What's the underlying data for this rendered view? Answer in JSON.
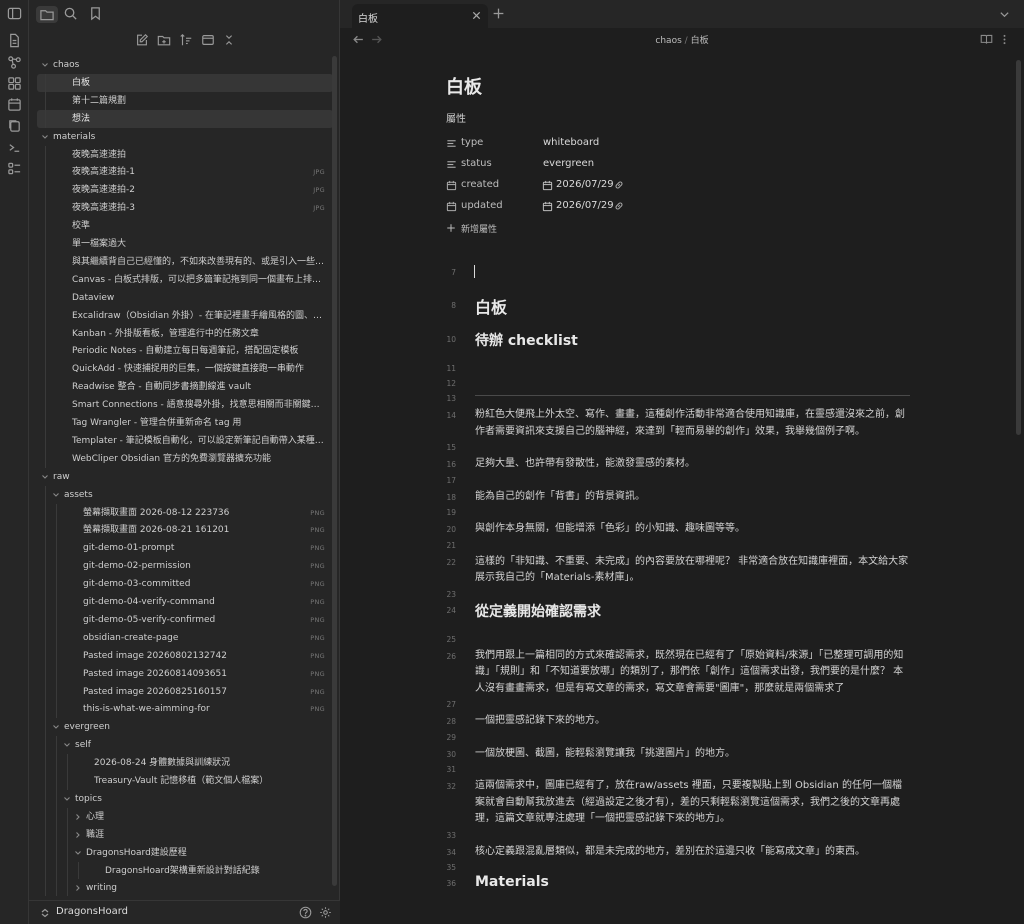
{
  "tab": {
    "title": "白板"
  },
  "breadcrumb": {
    "folder": "chaos",
    "separator": "/",
    "note": "白板"
  },
  "sidebar": {
    "vault_name": "DragonsHoard",
    "tree": [
      {
        "label": "chaos",
        "depth": 0,
        "type": "folder",
        "open": true
      },
      {
        "label": "白板",
        "depth": 1,
        "type": "file",
        "selected": true
      },
      {
        "label": "第十二篇規劃",
        "depth": 1,
        "type": "file"
      },
      {
        "label": "想法",
        "depth": 1,
        "type": "file",
        "selected": true
      },
      {
        "label": "materials",
        "depth": 0,
        "type": "folder",
        "open": true
      },
      {
        "label": "夜晚高速速拍",
        "depth": 1,
        "type": "file"
      },
      {
        "label": "夜晚高速速拍-1",
        "depth": 1,
        "type": "file",
        "ext": "JPG"
      },
      {
        "label": "夜晚高速速拍-2",
        "depth": 1,
        "type": "file",
        "ext": "JPG"
      },
      {
        "label": "夜晚高速速拍-3",
        "depth": 1,
        "type": "file",
        "ext": "JPG"
      },
      {
        "label": "校準",
        "depth": 1,
        "type": "file"
      },
      {
        "label": "單一檔案過大",
        "depth": 1,
        "type": "file"
      },
      {
        "label": "與其繼續背自己已經懂的，不如來改善現有的、或是引入一些新…",
        "depth": 1,
        "type": "file"
      },
      {
        "label": "Canvas - 白板式排版，可以把多篇筆記拖到同一個畫布上排篇聯",
        "depth": 1,
        "type": "file"
      },
      {
        "label": "Dataview",
        "depth": 1,
        "type": "file"
      },
      {
        "label": "Excalidraw（Obsidian 外掛）- 在筆記裡畫手繪風格的圖、流程…",
        "depth": 1,
        "type": "file"
      },
      {
        "label": "Kanban - 外掛版看板，管理進行中的任務文章",
        "depth": 1,
        "type": "file"
      },
      {
        "label": "Periodic Notes - 自動建立每日每週筆記，搭配固定模板",
        "depth": 1,
        "type": "file"
      },
      {
        "label": "QuickAdd - 快速捕捉用的巨集，一個按鍵直接跑一串動作",
        "depth": 1,
        "type": "file"
      },
      {
        "label": "Readwise 整合 - 自動同步書摘劃線進 vault",
        "depth": 1,
        "type": "file"
      },
      {
        "label": "Smart Connections - 語意搜尋外掛，找意思相關而非關鍵字相…",
        "depth": 1,
        "type": "file"
      },
      {
        "label": "Tag Wrangler - 管理合併重新命名 tag 用",
        "depth": 1,
        "type": "file"
      },
      {
        "label": "Templater - 筆記模板自動化，可以設定新筆記自動帶入某種格式",
        "depth": 1,
        "type": "file"
      },
      {
        "label": "WebCliper Obsidian 官方的免費瀏覽器擴充功能",
        "depth": 1,
        "type": "file"
      },
      {
        "label": "raw",
        "depth": 0,
        "type": "folder",
        "open": true
      },
      {
        "label": "assets",
        "depth": 1,
        "type": "folder",
        "open": true
      },
      {
        "label": "螢幕擷取畫面 2026-08-12 223736",
        "depth": 2,
        "type": "file",
        "ext": "PNG"
      },
      {
        "label": "螢幕擷取畫面 2026-08-21 161201",
        "depth": 2,
        "type": "file",
        "ext": "PNG"
      },
      {
        "label": "git-demo-01-prompt",
        "depth": 2,
        "type": "file",
        "ext": "PNG"
      },
      {
        "label": "git-demo-02-permission",
        "depth": 2,
        "type": "file",
        "ext": "PNG"
      },
      {
        "label": "git-demo-03-committed",
        "depth": 2,
        "type": "file",
        "ext": "PNG"
      },
      {
        "label": "git-demo-04-verify-command",
        "depth": 2,
        "type": "file",
        "ext": "PNG"
      },
      {
        "label": "git-demo-05-verify-confirmed",
        "depth": 2,
        "type": "file",
        "ext": "PNG"
      },
      {
        "label": "obsidian-create-page",
        "depth": 2,
        "type": "file",
        "ext": "PNG"
      },
      {
        "label": "Pasted image 20260802132742",
        "depth": 2,
        "type": "file",
        "ext": "PNG"
      },
      {
        "label": "Pasted image 20260814093651",
        "depth": 2,
        "type": "file",
        "ext": "PNG"
      },
      {
        "label": "Pasted image 20260825160157",
        "depth": 2,
        "type": "file",
        "ext": "PNG"
      },
      {
        "label": "this-is-what-we-aimming-for",
        "depth": 2,
        "type": "file",
        "ext": "PNG"
      },
      {
        "label": "evergreen",
        "depth": 1,
        "type": "folder",
        "open": true
      },
      {
        "label": "self",
        "depth": 2,
        "type": "folder",
        "open": true
      },
      {
        "label": "2026-08-24 身體數據與訓練狀況",
        "depth": 3,
        "type": "file"
      },
      {
        "label": "Treasury-Vault 記憶移植（範文個人檔案）",
        "depth": 3,
        "type": "file"
      },
      {
        "label": "topics",
        "depth": 2,
        "type": "folder",
        "open": true
      },
      {
        "label": "心理",
        "depth": 3,
        "type": "folder",
        "open": false
      },
      {
        "label": "職涯",
        "depth": 3,
        "type": "folder",
        "open": false
      },
      {
        "label": "DragonsHoard建設歷程",
        "depth": 3,
        "type": "folder",
        "open": true
      },
      {
        "label": "DragonsHoard架構重新設計對話紀錄",
        "depth": 4,
        "type": "file"
      },
      {
        "label": "writing",
        "depth": 3,
        "type": "folder",
        "open": false
      }
    ]
  },
  "note": {
    "title": "白板",
    "properties_heading": "屬性",
    "properties": [
      {
        "icon": "list-icon",
        "key": "type",
        "value": "whiteboard"
      },
      {
        "icon": "list-icon",
        "key": "status",
        "value": "evergreen"
      },
      {
        "icon": "calendar-icon",
        "key": "created",
        "value": "2026/07/29",
        "is_date": true
      },
      {
        "icon": "calendar-icon",
        "key": "updated",
        "value": "2026/07/29",
        "is_date": true
      }
    ],
    "add_property": "新增屬性",
    "lines": [
      {
        "n": "7",
        "kind": "cursor"
      },
      {
        "n": "8",
        "kind": "h1",
        "text": "白板"
      },
      {
        "n": "10",
        "kind": "h2",
        "text": "待辦 checklist"
      },
      {
        "n": "11",
        "kind": "empty"
      },
      {
        "n": "12",
        "kind": "empty"
      },
      {
        "n": "13",
        "kind": "empty"
      },
      {
        "n": "14",
        "kind": "p",
        "text": "粉紅色大便飛上外太空、寫作、畫畫，這種創作活動非常適合使用知識庫，在靈感還沒來之前，創作者需要資訊來支援自己的腦神經，來達到「輕而易舉的創作」效果，我舉幾個例子啊。"
      },
      {
        "n": "15",
        "kind": "empty"
      },
      {
        "n": "16",
        "kind": "p",
        "text": "足夠大量、也許帶有發散性，能激發靈感的素材。"
      },
      {
        "n": "17",
        "kind": "empty"
      },
      {
        "n": "18",
        "kind": "p",
        "text": "能為自己的創作「背書」的背景資訊。"
      },
      {
        "n": "19",
        "kind": "empty"
      },
      {
        "n": "20",
        "kind": "p",
        "text": "與創作本身無關，但能增添「色彩」的小知識、趣味圖等等。"
      },
      {
        "n": "21",
        "kind": "empty"
      },
      {
        "n": "22",
        "kind": "p",
        "text": "這樣的「非知識、不重要、未完成」的內容要放在哪裡呢？ 非常適合放在知識庫裡面，本文給大家展示我自己的「Materials-素材庫」。"
      },
      {
        "n": "23",
        "kind": "empty"
      },
      {
        "n": "24",
        "kind": "h2",
        "text": "從定義開始確認需求"
      },
      {
        "n": "25",
        "kind": "empty"
      },
      {
        "n": "26",
        "kind": "p",
        "text": "我們用跟上一篇相同的方式來確認需求，既然現在已經有了「原始資料/來源」「已整理可調用的知識」「規則」和「不知道要放哪」的類別了，那們依「創作」這個需求出發，我們要的是什麼？ 本人沒有畫畫需求，但是有寫文章的需求，寫文章會需要\"圖庫\"，那麼就是兩個需求了"
      },
      {
        "n": "27",
        "kind": "empty"
      },
      {
        "n": "28",
        "kind": "p",
        "text": "一個把靈感記錄下來的地方。"
      },
      {
        "n": "29",
        "kind": "empty"
      },
      {
        "n": "30",
        "kind": "p",
        "text": "一個放梗圖、截圖，能輕鬆瀏覽讓我「挑選圖片」的地方。"
      },
      {
        "n": "31",
        "kind": "empty"
      },
      {
        "n": "32",
        "kind": "p",
        "text": "這兩個需求中，圖庫已經有了，放在raw/assets 裡面，只要複製貼上到 Obsidian 的任何一個檔案就會自動幫我放進去（經過設定之後才有），差的只剩輕鬆瀏覽這個需求，我們之後的文章再處理，這篇文章就專注處理「一個把靈感記錄下來的地方」。"
      },
      {
        "n": "33",
        "kind": "empty"
      },
      {
        "n": "34",
        "kind": "p",
        "text": "核心定義跟混亂層類似，都是未完成的地方，差別在於這邊只收「能寫成文章」的東西。"
      },
      {
        "n": "35",
        "kind": "empty"
      },
      {
        "n": "36",
        "kind": "h2",
        "text": "Materials"
      }
    ]
  }
}
